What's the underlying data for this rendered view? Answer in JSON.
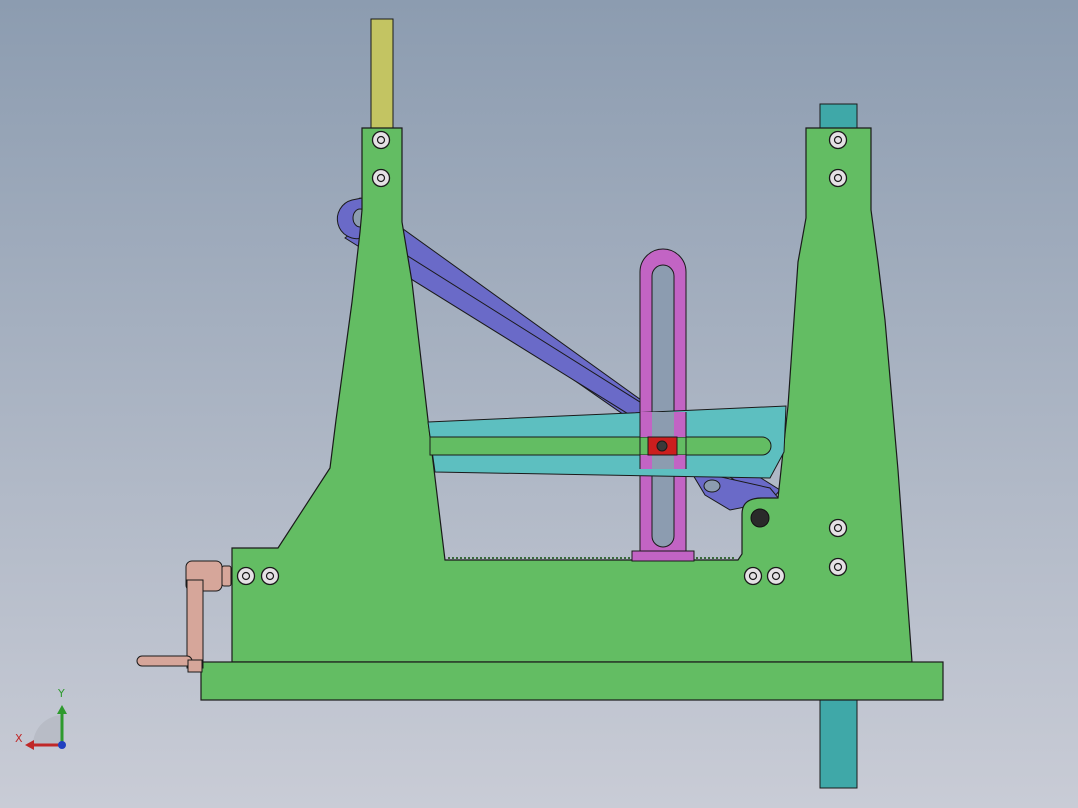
{
  "viewport": {
    "background_top": "#8c9cb0",
    "background_bottom": "#c9ccd6",
    "view": "front"
  },
  "colors": {
    "frame": "#63bd63",
    "base_plate": "#63bd63",
    "outline": "#1a1a1a",
    "link_arms": "#6a6ac8",
    "slotted_arm": "#5dbfc0",
    "vertical_slide": "#c264c4",
    "slider_block": "#cc1e1e",
    "left_rod": "#c3c462",
    "right_rod": "#3fa8a8",
    "crank_handle": "#d6a69a",
    "bolt_fill": "#e5e1e5"
  },
  "icons": {
    "bolt": "bolt-head-icon",
    "pin": "pin-icon",
    "triad": "axis-triad-icon"
  },
  "triad": {
    "x_label": "X",
    "y_label": "Y",
    "x_color": "#c02828",
    "y_color": "#2e9a2e",
    "z_color": "#2040c0"
  }
}
